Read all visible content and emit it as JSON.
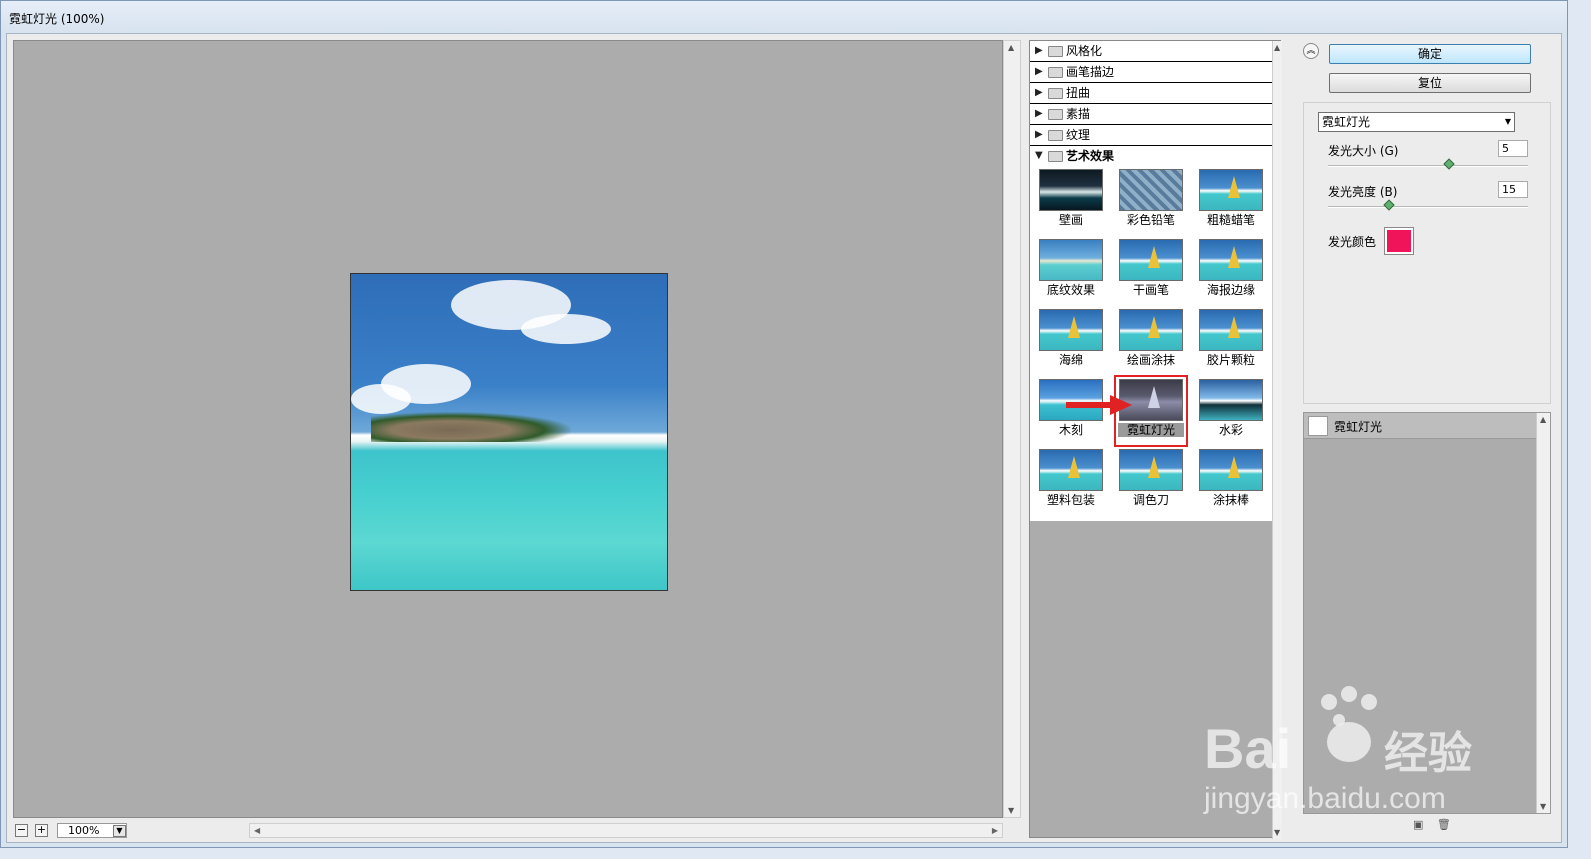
{
  "window": {
    "title": "霓虹灯光 (100%)"
  },
  "preview": {
    "zoom": "100%",
    "zoom_out": "−",
    "zoom_in": "+"
  },
  "gallery": {
    "categories": [
      {
        "label": "风格化",
        "expanded": false
      },
      {
        "label": "画笔描边",
        "expanded": false
      },
      {
        "label": "扭曲",
        "expanded": false
      },
      {
        "label": "素描",
        "expanded": false
      },
      {
        "label": "纹理",
        "expanded": false
      },
      {
        "label": "艺术效果",
        "expanded": true
      }
    ],
    "filters": [
      "壁画",
      "彩色铅笔",
      "粗糙蜡笔",
      "底纹效果",
      "干画笔",
      "海报边缘",
      "海绵",
      "绘画涂抹",
      "胶片颗粒",
      "木刻",
      "霓虹灯光",
      "水彩",
      "塑料包装",
      "调色刀",
      "涂抹棒"
    ],
    "selected": "霓虹灯光"
  },
  "buttons": {
    "ok": "确定",
    "reset": "复位"
  },
  "settings": {
    "filter_select": "霓虹灯光",
    "glow_size": {
      "label": "发光大小 (G)",
      "value": "5",
      "level": 0.6
    },
    "glow_brightness": {
      "label": "发光亮度 (B)",
      "value": "15",
      "level": 0.3
    },
    "glow_color": {
      "label": "发光颜色",
      "color": "#f0155a"
    }
  },
  "layers": {
    "items": [
      "霓虹灯光"
    ]
  },
  "watermark": {
    "text": "jingyan.baidu.com",
    "logo": "Bai du 经验"
  },
  "colors": {
    "accent_red": "#e02222",
    "glow": "#f0155a"
  }
}
